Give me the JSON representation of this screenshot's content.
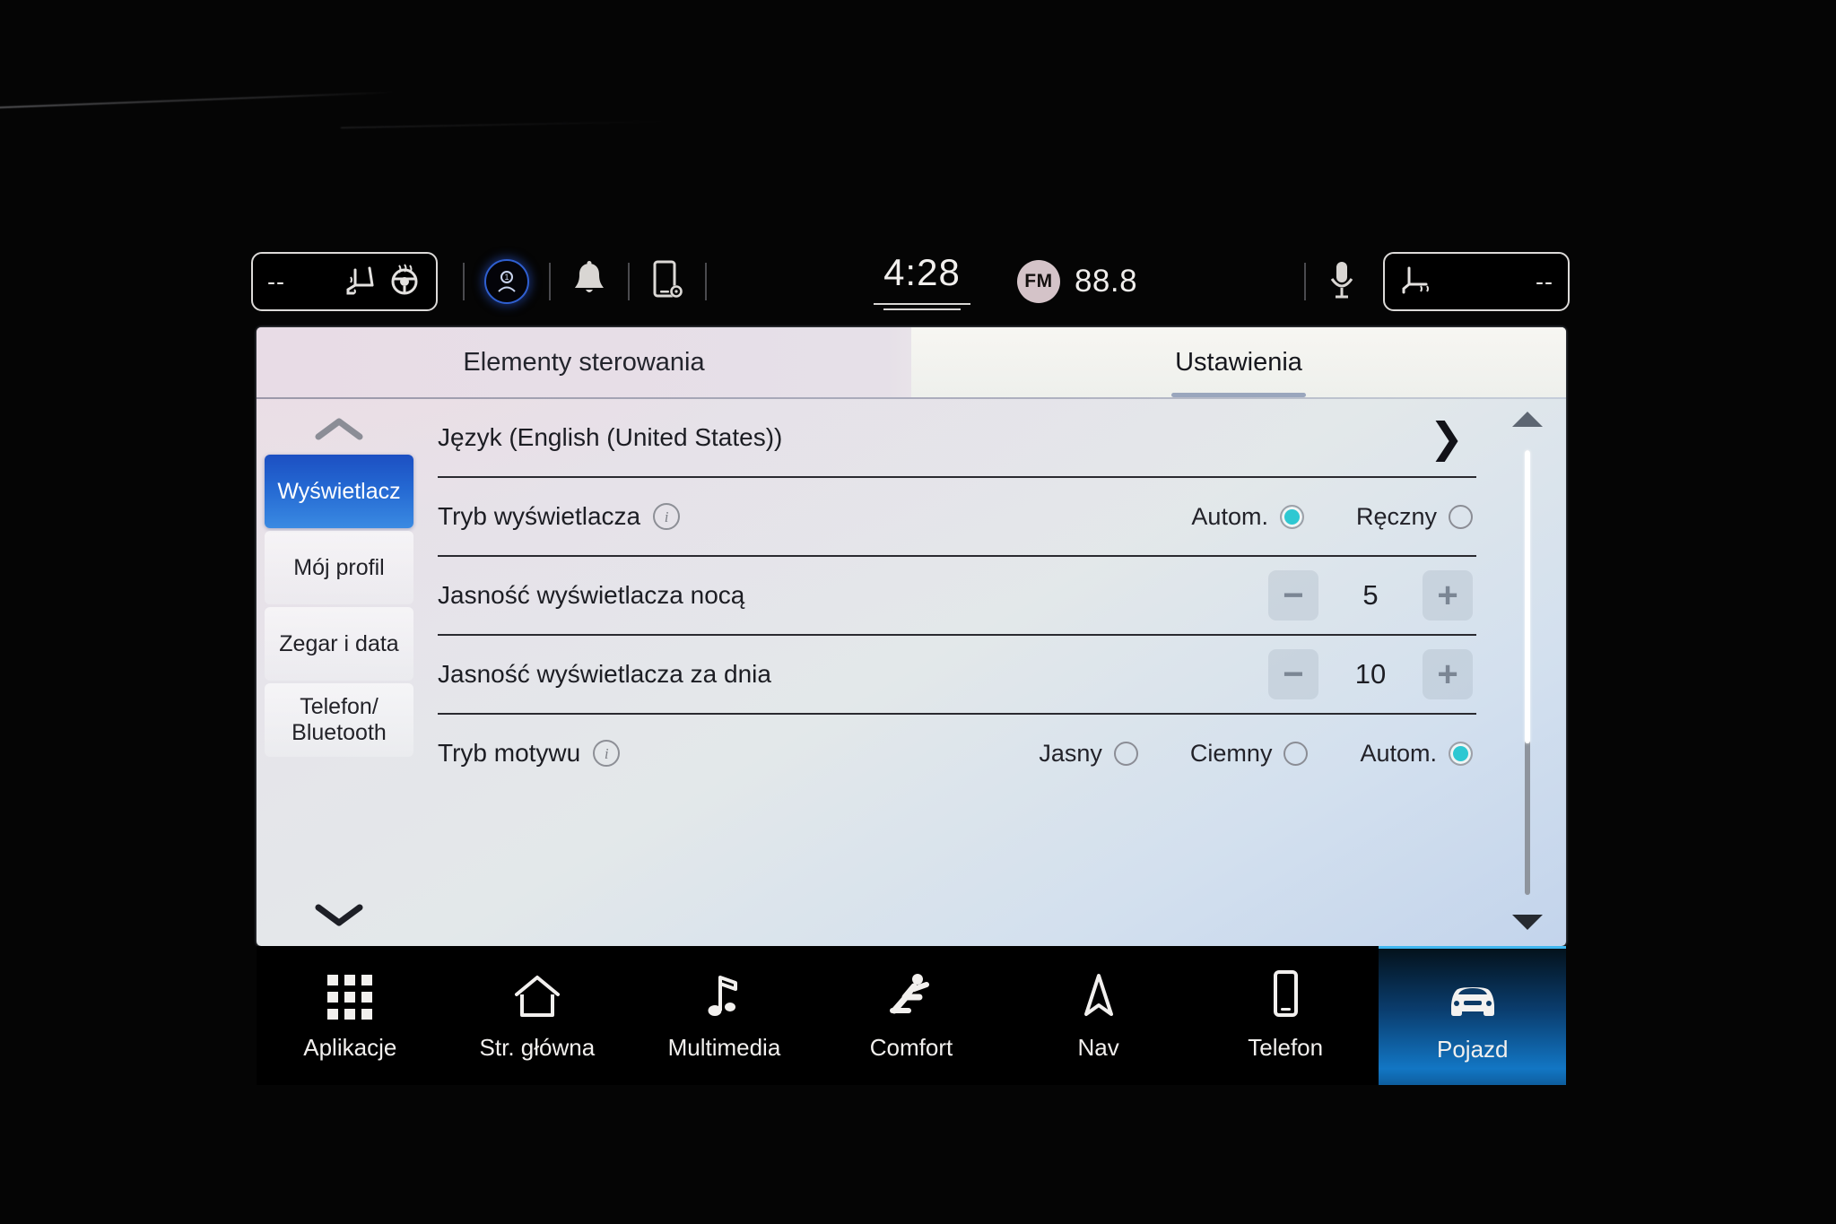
{
  "status_bar": {
    "left_climate": {
      "temperature": "--",
      "icons": [
        "heated-seat-icon",
        "heated-steering-wheel-icon"
      ]
    },
    "driver_badge": "driver-profile-icon",
    "notification_icon": "bell-icon",
    "phone_settings_icon": "phone-settings-icon",
    "clock": "4:28",
    "radio": {
      "band": "FM",
      "frequency": "88.8"
    },
    "microphone_icon": "microphone-icon",
    "right_climate": {
      "temperature": "--",
      "icons": [
        "heated-seat-icon"
      ]
    }
  },
  "tabs": [
    {
      "label": "Elementy sterowania",
      "active": false
    },
    {
      "label": "Ustawienia",
      "active": true
    }
  ],
  "sidebar": {
    "scroll_up_icon": "chevron-up-icon",
    "scroll_down_icon": "chevron-down-icon",
    "items": [
      {
        "label": "Wyświetlacz",
        "active": true
      },
      {
        "label": "Mój profil",
        "active": false
      },
      {
        "label": "Zegar i data",
        "active": false
      },
      {
        "label": "Telefon/\nBluetooth",
        "active": false
      }
    ]
  },
  "settings": {
    "language": {
      "label": "Język  (English (United States))",
      "chevron": "❯"
    },
    "display_mode": {
      "label": "Tryb wyświetlacza",
      "info_icon": "i",
      "options": [
        {
          "label": "Autom.",
          "selected": true
        },
        {
          "label": "Ręczny",
          "selected": false
        }
      ]
    },
    "brightness_night": {
      "label": "Jasność wyświetlacza nocą",
      "value": "5",
      "minus": "−",
      "plus": "+"
    },
    "brightness_day": {
      "label": "Jasność wyświetlacza za dnia",
      "value": "10",
      "minus": "−",
      "plus": "+"
    },
    "theme_mode": {
      "label": "Tryb motywu",
      "info_icon": "i",
      "options": [
        {
          "label": "Jasny",
          "selected": false
        },
        {
          "label": "Ciemny",
          "selected": false
        },
        {
          "label": "Autom.",
          "selected": true
        }
      ]
    }
  },
  "scrollbar": {
    "up_icon": "triangle-up-icon",
    "down_icon": "triangle-down-icon",
    "thumb_position_percent": 0
  },
  "bottom_nav": [
    {
      "label": "Aplikacje",
      "icon": "apps-grid-icon",
      "active": false
    },
    {
      "label": "Str. główna",
      "icon": "home-icon",
      "active": false
    },
    {
      "label": "Multimedia",
      "icon": "music-note-icon",
      "active": false
    },
    {
      "label": "Comfort",
      "icon": "seated-person-icon",
      "active": false
    },
    {
      "label": "Nav",
      "icon": "navigation-arrow-icon",
      "active": false
    },
    {
      "label": "Telefon",
      "icon": "smartphone-icon",
      "active": false
    },
    {
      "label": "Pojazd",
      "icon": "car-front-icon",
      "active": true
    }
  ],
  "colors": {
    "accent_blue": "#2468d2",
    "accent_teal": "#2ec8d2",
    "nav_active_blue": "#1276c4",
    "panel_text": "#1c1d23"
  }
}
